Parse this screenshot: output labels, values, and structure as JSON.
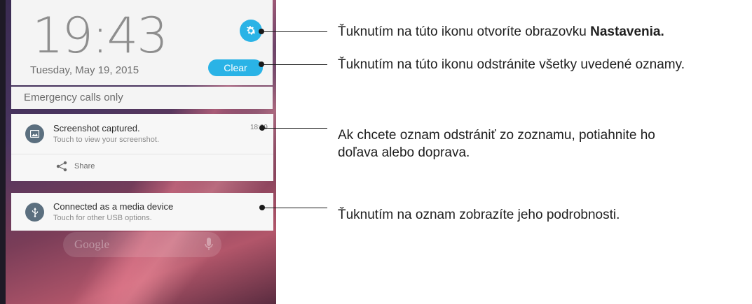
{
  "phone": {
    "clock": "19:43",
    "date": "Tuesday, May 19, 2015",
    "clear_label": "Clear",
    "emergency_text": "Emergency calls only",
    "notifications": [
      {
        "title": "Screenshot captured.",
        "subtitle": "Touch to view your screenshot.",
        "time": "18:39",
        "icon": "image-icon",
        "action_label": "Share"
      },
      {
        "title": "Connected as a media device",
        "subtitle": "Touch for other USB options.",
        "icon": "usb-icon"
      }
    ],
    "search_text": "Google",
    "accent_color": "#2ab3e6"
  },
  "callouts": [
    {
      "text": "Ťuknutím na túto ikonu otvoríte obrazovku ",
      "bold": "Nastavenia."
    },
    {
      "text": "Ťuknutím na túto ikonu odstránite všetky uvedené oznamy."
    },
    {
      "text": "Ak chcete oznam odstrániť zo zoznamu, potiahnite ho",
      "text2": "doľava alebo doprava."
    },
    {
      "text": "Ťuknutím na oznam zobrazíte jeho podrobnosti."
    }
  ]
}
